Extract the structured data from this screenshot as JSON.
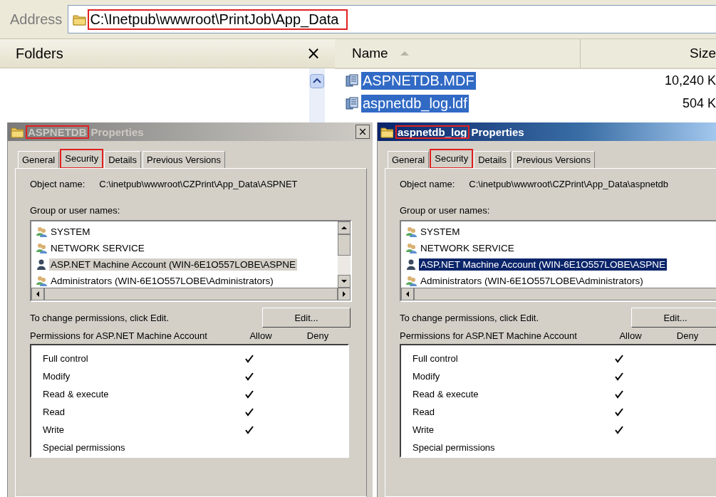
{
  "address_bar": {
    "label": "Address",
    "path": "C:\\Inetpub\\wwwroot\\PrintJob\\App_Data",
    "highlighted": true
  },
  "folders_pane": {
    "title": "Folders",
    "close": "×"
  },
  "file_list": {
    "columns": [
      "Name",
      "Size"
    ],
    "rows": [
      {
        "name": "ASPNETDB.MDF",
        "size": "10,240 K",
        "selected": true
      },
      {
        "name": "aspnetdb_log.ldf",
        "size": "504 K",
        "selected": true
      }
    ]
  },
  "dialogs": [
    {
      "title_name": "ASPNETDB",
      "title_highlighted": true,
      "title_suffix": "Properties",
      "active": false,
      "close": "×",
      "tabs": [
        {
          "label": "General",
          "selected": false,
          "highlighted": false
        },
        {
          "label": "Security",
          "selected": true,
          "highlighted": true
        },
        {
          "label": "Details",
          "selected": false,
          "highlighted": false
        },
        {
          "label": "Previous Versions",
          "selected": false,
          "highlighted": false
        }
      ],
      "object_label": "Object name:",
      "object_name": "C:\\inetpub\\wwwroot\\CZPrint\\App_Data\\ASPNET",
      "group_label": "Group or user names:",
      "users": [
        {
          "name": "SYSTEM",
          "kind": "group",
          "selected": false
        },
        {
          "name": "NETWORK SERVICE",
          "kind": "group",
          "selected": false
        },
        {
          "name": "ASP.NET Machine Account (WIN-6E1O557LOBE\\ASPNE",
          "kind": "user",
          "selected": true
        },
        {
          "name": "Administrators (WIN-6E1O557LOBE\\Administrators)",
          "kind": "group",
          "selected": false
        }
      ],
      "change_hint": "To change permissions, click Edit.",
      "edit_button": "Edit...",
      "permissions_label": "Permissions for ASP.NET Machine Account",
      "allow_heading": "Allow",
      "deny_heading": "Deny",
      "permissions": [
        {
          "name": "Full control",
          "allow": true,
          "deny": false
        },
        {
          "name": "Modify",
          "allow": true,
          "deny": false
        },
        {
          "name": "Read & execute",
          "allow": true,
          "deny": false
        },
        {
          "name": "Read",
          "allow": true,
          "deny": false
        },
        {
          "name": "Write",
          "allow": true,
          "deny": false
        },
        {
          "name": "Special permissions",
          "allow": false,
          "deny": false
        }
      ]
    },
    {
      "title_name": "aspnetdb_log",
      "title_highlighted": true,
      "title_suffix": "Properties",
      "active": true,
      "tabs": [
        {
          "label": "General",
          "selected": false,
          "highlighted": false
        },
        {
          "label": "Security",
          "selected": true,
          "highlighted": true
        },
        {
          "label": "Details",
          "selected": false,
          "highlighted": false
        },
        {
          "label": "Previous Versions",
          "selected": false,
          "highlighted": false
        }
      ],
      "object_label": "Object name:",
      "object_name": "C:\\inetpub\\wwwroot\\CZPrint\\App_Data\\aspnetdb",
      "group_label": "Group or user names:",
      "users": [
        {
          "name": "SYSTEM",
          "kind": "group",
          "selected": false
        },
        {
          "name": "NETWORK SERVICE",
          "kind": "group",
          "selected": false
        },
        {
          "name": "ASP.NET Machine Account (WIN-6E1O557LOBE\\ASPNE",
          "kind": "user",
          "selected": true
        },
        {
          "name": "Administrators (WIN-6E1O557LOBE\\Administrators)",
          "kind": "group",
          "selected": false
        }
      ],
      "change_hint": "To change permissions, click Edit.",
      "edit_button": "Edit...",
      "permissions_label": "Permissions for ASP.NET Machine Account",
      "allow_heading": "Allow",
      "deny_heading": "Deny",
      "permissions": [
        {
          "name": "Full control",
          "allow": true,
          "deny": false
        },
        {
          "name": "Modify",
          "allow": true,
          "deny": false
        },
        {
          "name": "Read & execute",
          "allow": true,
          "deny": false
        },
        {
          "name": "Read",
          "allow": true,
          "deny": false
        },
        {
          "name": "Write",
          "allow": true,
          "deny": false
        },
        {
          "name": "Special permissions",
          "allow": false,
          "deny": false
        }
      ]
    }
  ]
}
